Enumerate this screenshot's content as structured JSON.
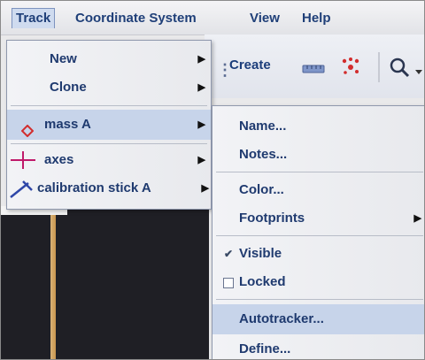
{
  "menubar": {
    "items": [
      "Track",
      "Coordinate System",
      "View",
      "Help"
    ]
  },
  "toolbar": {
    "create_label": "Create"
  },
  "track_menu": {
    "items": [
      {
        "label": "New",
        "submenu": true
      },
      {
        "label": "Clone",
        "submenu": true
      },
      {
        "label": "mass A",
        "submenu": true,
        "icon": "diamond-icon",
        "highlighted": true
      },
      {
        "label": "axes",
        "submenu": true,
        "icon": "axes-cross-icon"
      },
      {
        "label": "calibration stick A",
        "submenu": true,
        "icon": "calibration-stick-icon"
      }
    ]
  },
  "mass_submenu": {
    "items": [
      {
        "label": "Name...",
        "submenu": false
      },
      {
        "label": "Notes...",
        "submenu": false
      },
      {
        "label": "Color...",
        "submenu": false
      },
      {
        "label": "Footprints",
        "submenu": true
      },
      {
        "label": "Visible",
        "checked": true
      },
      {
        "label": "Locked",
        "checked": false
      },
      {
        "label": "Autotracker...",
        "highlighted": true
      },
      {
        "label": "Define..."
      }
    ]
  },
  "colors": {
    "menu_text": "#1f3a6f",
    "highlight": "#c7d4ea",
    "accent_red": "#d22d2d",
    "stick_orange": "#c9964e"
  }
}
